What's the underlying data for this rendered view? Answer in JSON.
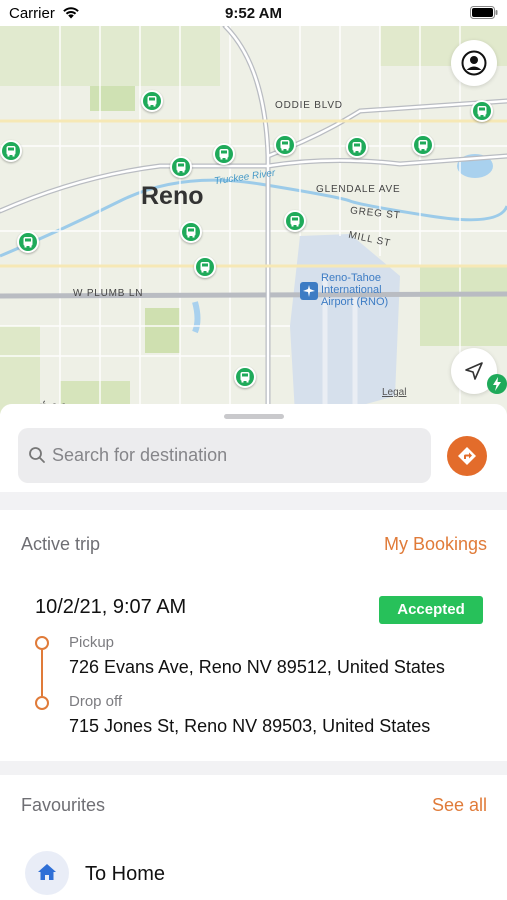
{
  "status_bar": {
    "carrier": "Carrier",
    "time": "9:52 AM"
  },
  "map": {
    "city_label": "Reno",
    "streets": [
      "ODDIE BLVD",
      "GLENDALE AVE",
      "GREG ST",
      "MILL ST",
      "W PLUMB LN"
    ],
    "river_label": "Truckee River",
    "airport_label": [
      "Reno-Tahoe",
      "International",
      "Airport (RNO)"
    ],
    "brand": "Maps",
    "legal": "Legal",
    "stop_icon": "bus-stop-icon"
  },
  "search": {
    "placeholder": "Search for destination",
    "value": ""
  },
  "active_trip": {
    "heading": "Active trip",
    "link": "My Bookings",
    "datetime": "10/2/21, 9:07 AM",
    "status": "Accepted",
    "pickup_label": "Pickup",
    "pickup_address": "726 Evans Ave, Reno NV 89512, United States",
    "dropoff_label": "Drop off",
    "dropoff_address": "715 Jones St, Reno NV 89503, United States"
  },
  "favourites": {
    "heading": "Favourites",
    "link": "See all",
    "items": [
      {
        "label": "To Home",
        "icon": "home-icon"
      }
    ]
  },
  "colors": {
    "accent": "#e07b39",
    "status_green": "#27c15a",
    "bus_green": "#1faa5a"
  }
}
